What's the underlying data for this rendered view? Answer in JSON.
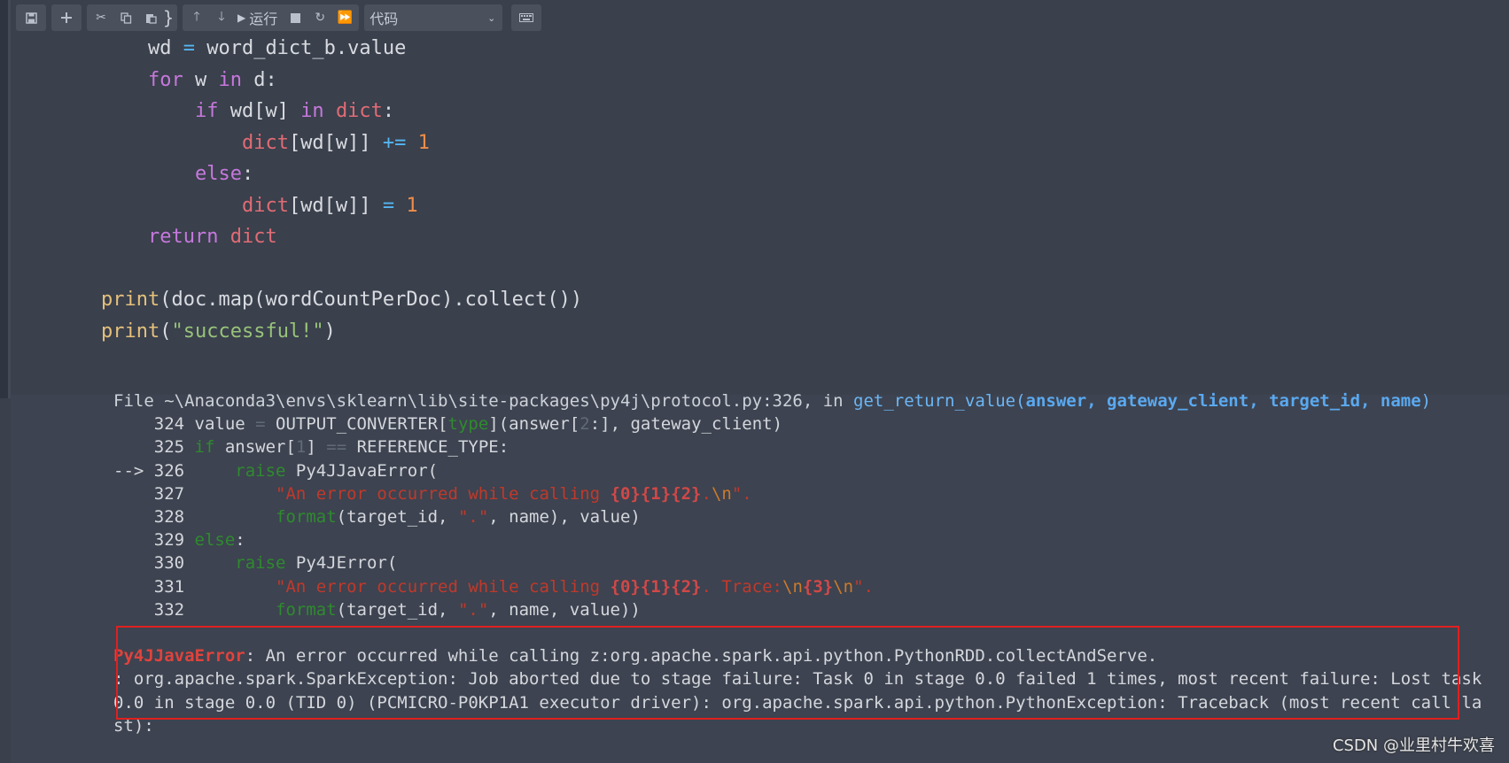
{
  "toolbar": {
    "save_icon": "save-icon",
    "insert_icon": "plus-icon",
    "cut_icon": "scissors-icon",
    "copy_icon": "copy-icon",
    "paste_icon": "paste-icon",
    "peek_text": "}",
    "move_up_icon": "arrow-up-icon",
    "move_down_icon": "arrow-down-icon",
    "run_label": "运行",
    "stop_icon": "stop-icon",
    "restart_icon": "restart-icon",
    "fast_forward_icon": "fast-forward-icon",
    "cell_type_value": "代码",
    "keyboard_icon": "keyboard-icon"
  },
  "code_cell": {
    "lines": [
      [
        {
          "t": "    wd ",
          "c": "var"
        },
        {
          "t": "=",
          "c": "op"
        },
        {
          "t": " word_dict_b.value",
          "c": "var"
        }
      ],
      [
        {
          "t": "    ",
          "c": "var"
        },
        {
          "t": "for",
          "c": "kw"
        },
        {
          "t": " w ",
          "c": "var"
        },
        {
          "t": "in",
          "c": "kw"
        },
        {
          "t": " d:",
          "c": "var"
        }
      ],
      [
        {
          "t": "        ",
          "c": "var"
        },
        {
          "t": "if",
          "c": "kw"
        },
        {
          "t": " wd[w] ",
          "c": "var"
        },
        {
          "t": "in",
          "c": "kw"
        },
        {
          "t": " ",
          "c": "var"
        },
        {
          "t": "dict",
          "c": "bi"
        },
        {
          "t": ":",
          "c": "var"
        }
      ],
      [
        {
          "t": "            ",
          "c": "var"
        },
        {
          "t": "dict",
          "c": "bi"
        },
        {
          "t": "[wd[w]] ",
          "c": "var"
        },
        {
          "t": "+=",
          "c": "op"
        },
        {
          "t": " ",
          "c": "var"
        },
        {
          "t": "1",
          "c": "num"
        }
      ],
      [
        {
          "t": "        ",
          "c": "var"
        },
        {
          "t": "else",
          "c": "kw"
        },
        {
          "t": ":",
          "c": "var"
        }
      ],
      [
        {
          "t": "            ",
          "c": "var"
        },
        {
          "t": "dict",
          "c": "bi"
        },
        {
          "t": "[wd[w]] ",
          "c": "var"
        },
        {
          "t": "=",
          "c": "op"
        },
        {
          "t": " ",
          "c": "var"
        },
        {
          "t": "1",
          "c": "num"
        }
      ],
      [
        {
          "t": "    ",
          "c": "var"
        },
        {
          "t": "return",
          "c": "kw"
        },
        {
          "t": " ",
          "c": "var"
        },
        {
          "t": "dict",
          "c": "bi"
        }
      ],
      [
        {
          "t": "",
          "c": "var"
        }
      ],
      [
        {
          "t": "print",
          "c": "fn"
        },
        {
          "t": "(doc.map(wordCountPerDoc).collect())",
          "c": "var"
        }
      ],
      [
        {
          "t": "print",
          "c": "fn"
        },
        {
          "t": "(",
          "c": "var"
        },
        {
          "t": "\"successful!\"",
          "c": "str"
        },
        {
          "t": ")",
          "c": "var"
        }
      ]
    ]
  },
  "output": {
    "lines": [
      [
        {
          "t": "File ~\\Anaconda3\\envs\\sklearn\\lib\\site-packages\\py4j\\protocol.py:326, in ",
          "c": "o-path"
        },
        {
          "t": "get_return_value",
          "c": "o-func"
        },
        {
          "t": "(",
          "c": "o-func"
        },
        {
          "t": "answer, gateway_client, target_id, name",
          "c": "o-args"
        },
        {
          "t": ")",
          "c": "o-func"
        }
      ],
      [
        {
          "t": "    324 ",
          "c": "lnum"
        },
        {
          "t": "value ",
          "c": "lnum"
        },
        {
          "t": "=",
          "c": "o-dim"
        },
        {
          "t": " OUTPUT_CONVERTER[",
          "c": "lnum"
        },
        {
          "t": "type",
          "c": "o-green"
        },
        {
          "t": "](answer[",
          "c": "lnum"
        },
        {
          "t": "2",
          "c": "o-dim"
        },
        {
          "t": ":], gateway_client)",
          "c": "lnum"
        }
      ],
      [
        {
          "t": "    325 ",
          "c": "lnum"
        },
        {
          "t": "if",
          "c": "o-green"
        },
        {
          "t": " answer[",
          "c": "lnum"
        },
        {
          "t": "1",
          "c": "o-dim"
        },
        {
          "t": "] ",
          "c": "lnum"
        },
        {
          "t": "==",
          "c": "o-dim"
        },
        {
          "t": " REFERENCE_TYPE:",
          "c": "lnum"
        }
      ],
      [
        {
          "t": "--> 326     ",
          "c": "lnum"
        },
        {
          "t": "raise",
          "c": "o-green"
        },
        {
          "t": " Py4JJavaError(",
          "c": "lnum"
        }
      ],
      [
        {
          "t": "    327         ",
          "c": "lnum"
        },
        {
          "t": "\"An error occurred while calling ",
          "c": "o-red"
        },
        {
          "t": "{0}{1}{2}",
          "c": "o-redb"
        },
        {
          "t": ".",
          "c": "o-red"
        },
        {
          "t": "\\n",
          "c": "o-orange"
        },
        {
          "t": "\".",
          "c": "o-red"
        }
      ],
      [
        {
          "t": "    328         ",
          "c": "lnum"
        },
        {
          "t": "format",
          "c": "o-green"
        },
        {
          "t": "(target_id, ",
          "c": "lnum"
        },
        {
          "t": "\".\"",
          "c": "o-red"
        },
        {
          "t": ", name), value)",
          "c": "lnum"
        }
      ],
      [
        {
          "t": "    329 ",
          "c": "lnum"
        },
        {
          "t": "else",
          "c": "o-green"
        },
        {
          "t": ":",
          "c": "lnum"
        }
      ],
      [
        {
          "t": "    330     ",
          "c": "lnum"
        },
        {
          "t": "raise",
          "c": "o-green"
        },
        {
          "t": " Py4JError(",
          "c": "lnum"
        }
      ],
      [
        {
          "t": "    331         ",
          "c": "lnum"
        },
        {
          "t": "\"An error occurred while calling ",
          "c": "o-red"
        },
        {
          "t": "{0}{1}{2}",
          "c": "o-redb"
        },
        {
          "t": ". Trace:",
          "c": "o-red"
        },
        {
          "t": "\\n",
          "c": "o-orange"
        },
        {
          "t": "{3}",
          "c": "o-redb"
        },
        {
          "t": "\\n",
          "c": "o-orange"
        },
        {
          "t": "\".",
          "c": "o-red"
        }
      ],
      [
        {
          "t": "    332         ",
          "c": "lnum"
        },
        {
          "t": "format",
          "c": "o-green"
        },
        {
          "t": "(target_id, ",
          "c": "lnum"
        },
        {
          "t": "\".\"",
          "c": "o-red"
        },
        {
          "t": ", name, value))",
          "c": "lnum"
        }
      ],
      [
        {
          "t": "",
          "c": "lnum"
        }
      ],
      [
        {
          "t": "Py4JJavaError",
          "c": "o-err"
        },
        {
          "t": ": An error occurred while calling z:org.apache.spark.api.python.PythonRDD.collectAndServe.",
          "c": "lnum"
        }
      ],
      [
        {
          "t": ": org.apache.spark.SparkException: Job aborted due to stage failure: Task 0 in stage 0.0 failed 1 times, most recent failure: Lost task",
          "c": "lnum"
        }
      ],
      [
        {
          "t": "0.0 in stage 0.0 (TID 0) (PCMICRO-P0KP1A1 executor driver): org.apache.spark.api.python.PythonException: Traceback (most recent call la",
          "c": "lnum"
        }
      ],
      [
        {
          "t": "st):",
          "c": "lnum"
        }
      ]
    ]
  },
  "watermark": "CSDN @业里村牛欢喜",
  "colors": {
    "background": "#3a404c",
    "highlight_border": "#e02020",
    "error_name": "#e0433c"
  }
}
